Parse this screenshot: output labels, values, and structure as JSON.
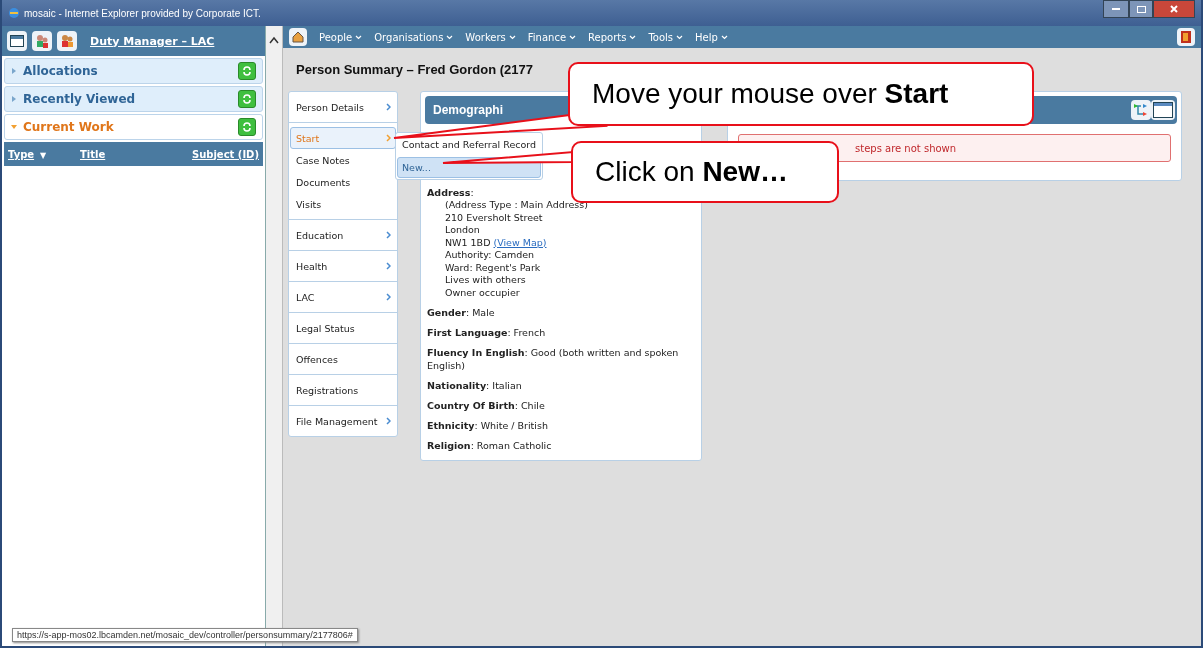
{
  "window": {
    "title": "mosaic - Internet Explorer provided by Corporate ICT."
  },
  "left_pane": {
    "user_link": "Duty Manager – LAC",
    "sections": [
      {
        "label": "Allocations",
        "expanded": false
      },
      {
        "label": "Recently Viewed",
        "expanded": false
      },
      {
        "label": "Current Work",
        "expanded": true
      }
    ],
    "table": {
      "columns": [
        {
          "label": "Type",
          "sort": "▼"
        },
        {
          "label": "Title"
        },
        {
          "label": "Subject (ID)"
        }
      ]
    }
  },
  "nav": {
    "menus": [
      "People",
      "Organisations",
      "Workers",
      "Finance",
      "Reports",
      "Tools",
      "Help"
    ]
  },
  "page_title": "Person Summary – Fred Gordon (2177",
  "side_menu": [
    {
      "items": [
        {
          "label": "Person Details",
          "has_submenu": true,
          "selected": false
        }
      ]
    },
    {
      "items": [
        {
          "label": "Start",
          "has_submenu": true,
          "selected": true
        },
        {
          "label": "Case Notes",
          "has_submenu": false,
          "selected": false
        },
        {
          "label": "Documents",
          "has_submenu": false,
          "selected": false
        },
        {
          "label": "Visits",
          "has_submenu": false,
          "selected": false
        }
      ]
    },
    {
      "items": [
        {
          "label": "Education",
          "has_submenu": true,
          "selected": false
        }
      ]
    },
    {
      "items": [
        {
          "label": "Health",
          "has_submenu": true,
          "selected": false
        }
      ]
    },
    {
      "items": [
        {
          "label": "LAC",
          "has_submenu": true,
          "selected": false
        }
      ]
    },
    {
      "items": [
        {
          "label": "Legal Status",
          "has_submenu": false,
          "selected": false
        }
      ]
    },
    {
      "items": [
        {
          "label": "Offences",
          "has_submenu": false,
          "selected": false
        }
      ]
    },
    {
      "items": [
        {
          "label": "Registrations",
          "has_submenu": false,
          "selected": false
        }
      ]
    },
    {
      "items": [
        {
          "label": "File Management",
          "has_submenu": true,
          "selected": false
        }
      ]
    }
  ],
  "submenu": [
    {
      "label": "Contact and Referral Record",
      "selected": false
    },
    {
      "label": "New...",
      "selected": true
    }
  ],
  "demographics": {
    "heading": "Demographi",
    "address": {
      "label": "**Address**:",
      "lines": [
        {
          "text": "(Address Type : Main Address)"
        },
        {
          "text": "210 Eversholt Street"
        },
        {
          "text": "London"
        },
        {
          "text": "NW1 1BD",
          "link": "(View Map)"
        },
        {
          "text": "Authority: Camden"
        },
        {
          "text": "Ward: Regent's Park"
        },
        {
          "text": "Lives with others"
        },
        {
          "text": "Owner occupier"
        }
      ]
    },
    "fields": [
      {
        "text": "**Gender**:  Male"
      },
      {
        "text": "**First Language**:  French"
      },
      {
        "text": "**Fluency In English**:  Good (both written and spoken English)"
      },
      {
        "text": "**Nationality**:  Italian"
      },
      {
        "text": "**Country Of Birth**:  Chile"
      },
      {
        "text": "**Ethnicity**:  White / British"
      },
      {
        "text": "**Religion**:  Roman Catholic"
      }
    ]
  },
  "workflow_panel": {
    "alert": "steps are not shown"
  },
  "status_url": "https://s-app-mos02.lbcamden.net/mosaic_dev/controller/personsummary/2177806#",
  "callouts": [
    {
      "text": "Move your mouse over **Start**"
    },
    {
      "text": "Click on **New…**"
    }
  ]
}
